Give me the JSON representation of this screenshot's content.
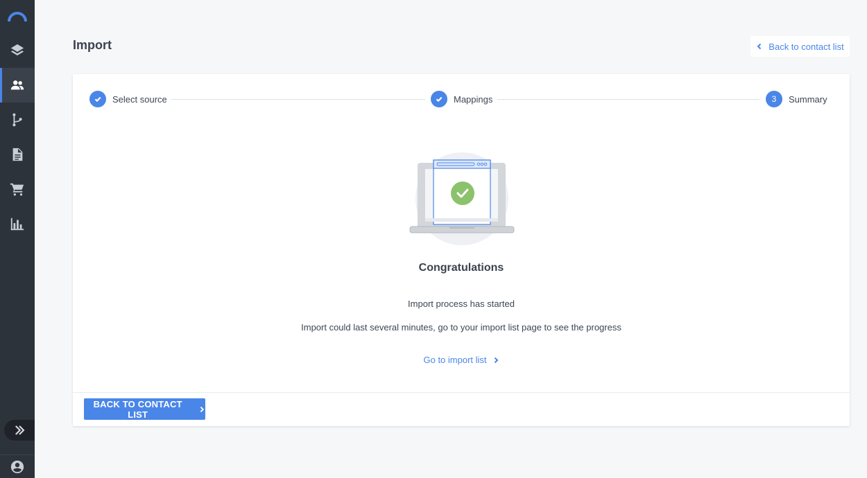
{
  "header": {
    "title": "Import",
    "back_link_label": "Back to contact list"
  },
  "sidebar": {
    "items": [
      {
        "icon": "layers-icon"
      },
      {
        "icon": "contacts-icon",
        "active": true
      },
      {
        "icon": "workflow-icon"
      },
      {
        "icon": "document-icon"
      },
      {
        "icon": "cart-icon"
      },
      {
        "icon": "bar-chart-icon"
      }
    ]
  },
  "steps": [
    {
      "label": "Select source",
      "status": "done"
    },
    {
      "label": "Mappings",
      "status": "done"
    },
    {
      "number": "3",
      "label": "Summary",
      "status": "current"
    }
  ],
  "result": {
    "heading": "Congratulations",
    "message": "Import process has started",
    "detail": "Import could last several minutes, go to your import list page to see the progress",
    "link_label": "Go to import list"
  },
  "footer": {
    "button_label": "BACK TO CONTACT LIST"
  },
  "colors": {
    "accent": "#4a86e8",
    "sidebar": "#2d333b",
    "success": "#8bc26b"
  }
}
